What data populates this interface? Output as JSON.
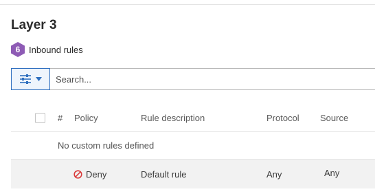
{
  "section": {
    "title": "Layer 3",
    "rule_count": "6",
    "rule_type": "Inbound rules",
    "badge_color": "#8e5bb5"
  },
  "search": {
    "placeholder": "Search..."
  },
  "icons": {
    "filter": "sliders-icon",
    "dropdown": "caret-down-icon",
    "deny": "no-entry-icon"
  },
  "table": {
    "columns": {
      "number": "#",
      "policy": "Policy",
      "description": "Rule description",
      "protocol": "Protocol",
      "source": "Source"
    },
    "empty_message": "No custom rules defined",
    "default_rule": {
      "policy": "Deny",
      "description": "Default rule",
      "protocol": "Any",
      "source": "Any"
    }
  },
  "colors": {
    "accent": "#2f6fbf",
    "deny_red": "#d93a3a"
  }
}
